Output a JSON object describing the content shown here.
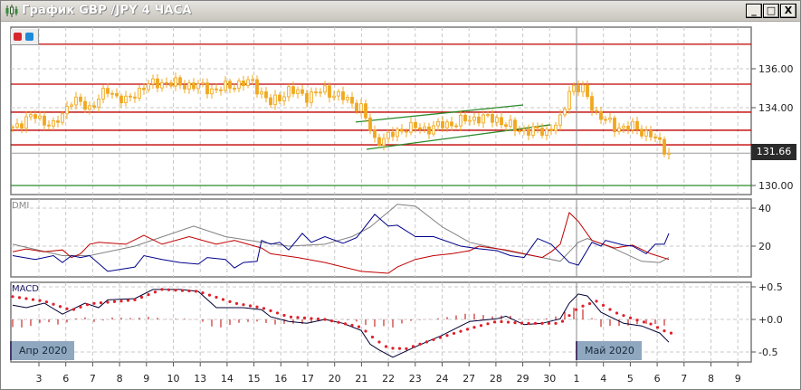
{
  "window": {
    "title": "График GBP /JPY  4 ЧАСА",
    "minimize_label": "_",
    "maximize_label": "□",
    "close_label": "X"
  },
  "colors": {
    "candle": "#f0a820",
    "level": "#c00000",
    "trend": "#2a8a2a",
    "adx": "#808080",
    "plus_di": "#c00000",
    "minus_di": "#00008b",
    "macd": "#000033",
    "signal": "#e0202a",
    "histogram": "#c00000"
  },
  "current_price": "131.66",
  "indicators": {
    "dmi_label": "DMI",
    "macd_label": "MACD"
  },
  "months": {
    "apr": "Апр 2020",
    "may": "Май 2020"
  },
  "chart_data": {
    "type": "line",
    "title": "GBP/JPY 4H",
    "x_tick_labels": [
      "3",
      "6",
      "7",
      "8",
      "9",
      "10",
      "13",
      "14",
      "15",
      "16",
      "17",
      "20",
      "21",
      "22",
      "23",
      "24",
      "27",
      "28",
      "29",
      "30",
      "1",
      "4",
      "5",
      "6",
      "7",
      "8",
      "9"
    ],
    "price_axis": {
      "ticks": [
        "136.00",
        "134.00",
        "130.00"
      ],
      "tick_values": [
        136,
        134,
        130
      ],
      "ylim": [
        129.5,
        138.2
      ]
    },
    "price_close_keypoints": [
      [
        0,
        133.0
      ],
      [
        5,
        133.6
      ],
      [
        9,
        133.0
      ],
      [
        13,
        134.4
      ],
      [
        17,
        134.0
      ],
      [
        21,
        134.9
      ],
      [
        25,
        134.3
      ],
      [
        29,
        135.1
      ],
      [
        33,
        135.3
      ],
      [
        37,
        135.2
      ],
      [
        41,
        135.1
      ],
      [
        45,
        134.9
      ],
      [
        49,
        135.2
      ],
      [
        53,
        135.3
      ],
      [
        57,
        134.2
      ],
      [
        61,
        134.9
      ],
      [
        65,
        134.6
      ],
      [
        69,
        134.9
      ],
      [
        73,
        134.5
      ],
      [
        77,
        134.0
      ],
      [
        80,
        132.3
      ],
      [
        83,
        132.5
      ],
      [
        87,
        133.0
      ],
      [
        91,
        132.9
      ],
      [
        95,
        133.1
      ],
      [
        99,
        133.3
      ],
      [
        103,
        133.5
      ],
      [
        107,
        133.4
      ],
      [
        111,
        132.9
      ],
      [
        115,
        132.8
      ],
      [
        118,
        132.8
      ],
      [
        121,
        133.3
      ],
      [
        123,
        134.9
      ],
      [
        124,
        135.1
      ],
      [
        126,
        134.9
      ],
      [
        129,
        133.7
      ],
      [
        133,
        133.0
      ],
      [
        137,
        133.0
      ],
      [
        141,
        132.6
      ],
      [
        144,
        131.9
      ],
      [
        145,
        131.66
      ]
    ],
    "horizontal_levels": [
      137.26,
      135.21,
      133.77,
      132.84,
      132.09
    ],
    "support_level": 130.0,
    "trend_lines": [
      [
        [
          75.8,
          133.26
        ],
        [
          112.8,
          134.14
        ]
      ],
      [
        [
          78.2,
          131.86
        ],
        [
          118.8,
          133.12
        ]
      ]
    ],
    "dmi": {
      "ticks": [
        "40",
        "20"
      ],
      "tick_values": [
        40,
        20
      ],
      "ylim": [
        3.8,
        44.8
      ],
      "adx": [
        [
          0,
          21
        ],
        [
          11,
          15
        ],
        [
          17,
          15
        ],
        [
          27,
          20
        ],
        [
          40,
          30.5
        ],
        [
          47,
          25
        ],
        [
          55,
          22
        ],
        [
          61,
          20
        ],
        [
          69,
          21
        ],
        [
          75,
          25
        ],
        [
          79,
          30
        ],
        [
          85,
          42
        ],
        [
          89,
          41
        ],
        [
          95,
          30
        ],
        [
          101,
          22
        ],
        [
          109,
          17.6
        ],
        [
          117,
          14
        ],
        [
          121,
          12
        ],
        [
          125,
          22
        ],
        [
          127,
          24
        ],
        [
          133,
          18.6
        ],
        [
          139,
          12
        ],
        [
          143,
          11.4
        ],
        [
          145,
          14
        ]
      ],
      "plus_di": [
        [
          0,
          17
        ],
        [
          3,
          18.5
        ],
        [
          7,
          17
        ],
        [
          11,
          18
        ],
        [
          13,
          14
        ],
        [
          15,
          16
        ],
        [
          17,
          21
        ],
        [
          19,
          22
        ],
        [
          25,
          21
        ],
        [
          29,
          25.7
        ],
        [
          33,
          21
        ],
        [
          39,
          25
        ],
        [
          45,
          21
        ],
        [
          49,
          23
        ],
        [
          55,
          19
        ],
        [
          57,
          16
        ],
        [
          63,
          14
        ],
        [
          69,
          11.4
        ],
        [
          77,
          6.7
        ],
        [
          83,
          5.7
        ],
        [
          85,
          9
        ],
        [
          89,
          13
        ],
        [
          93,
          15
        ],
        [
          97,
          16
        ],
        [
          101,
          17.6
        ],
        [
          103,
          20
        ],
        [
          109,
          18
        ],
        [
          117,
          14
        ],
        [
          119,
          17
        ],
        [
          121,
          21
        ],
        [
          123,
          37.6
        ],
        [
          125,
          33
        ],
        [
          128,
          23
        ],
        [
          133,
          19
        ],
        [
          137,
          20.5
        ],
        [
          141,
          16
        ],
        [
          145,
          13
        ]
      ],
      "minus_di": [
        [
          0,
          15
        ],
        [
          5,
          13
        ],
        [
          9,
          15
        ],
        [
          11,
          11.4
        ],
        [
          13,
          15
        ],
        [
          15,
          14
        ],
        [
          17,
          15
        ],
        [
          21,
          6.7
        ],
        [
          27,
          9
        ],
        [
          29,
          15
        ],
        [
          33,
          13
        ],
        [
          37,
          11.4
        ],
        [
          41,
          10.5
        ],
        [
          43,
          14
        ],
        [
          47,
          13
        ],
        [
          49,
          8.5
        ],
        [
          51,
          11.4
        ],
        [
          54,
          12
        ],
        [
          55,
          23
        ],
        [
          57,
          21
        ],
        [
          59,
          22
        ],
        [
          61,
          18
        ],
        [
          64,
          26.7
        ],
        [
          66,
          22
        ],
        [
          69,
          25
        ],
        [
          73,
          21.5
        ],
        [
          76,
          24.5
        ],
        [
          80,
          36.7
        ],
        [
          83,
          30.5
        ],
        [
          85,
          31
        ],
        [
          89,
          25
        ],
        [
          93,
          25
        ],
        [
          99,
          20
        ],
        [
          103,
          18.6
        ],
        [
          107,
          17.6
        ],
        [
          110,
          15
        ],
        [
          113,
          14
        ],
        [
          116,
          24
        ],
        [
          119,
          21
        ],
        [
          123,
          11.4
        ],
        [
          125,
          10
        ],
        [
          128,
          22
        ],
        [
          130,
          20
        ],
        [
          131,
          23
        ],
        [
          135,
          20.5
        ],
        [
          137,
          20
        ],
        [
          140,
          16
        ],
        [
          142,
          21
        ],
        [
          144,
          21
        ],
        [
          145,
          26.7
        ]
      ]
    },
    "macd": {
      "ticks": [
        "+0.5",
        "+0.0",
        "-0.5"
      ],
      "tick_values": [
        0.5,
        0,
        -0.5
      ],
      "ylim": [
        -0.65,
        0.6
      ],
      "main": [
        [
          0,
          0.22
        ],
        [
          3,
          0.18
        ],
        [
          7,
          0.25
        ],
        [
          11,
          0.08
        ],
        [
          16,
          0.25
        ],
        [
          19,
          0.18
        ],
        [
          21,
          0.3
        ],
        [
          27,
          0.32
        ],
        [
          31,
          0.46
        ],
        [
          37,
          0.46
        ],
        [
          41,
          0.43
        ],
        [
          45,
          0.18
        ],
        [
          51,
          0.18
        ],
        [
          55,
          0.15
        ],
        [
          57,
          0.04
        ],
        [
          61,
          -0.03
        ],
        [
          65,
          -0.06
        ],
        [
          69,
          0.0
        ],
        [
          73,
          -0.06
        ],
        [
          77,
          -0.17
        ],
        [
          79,
          -0.38
        ],
        [
          81,
          -0.47
        ],
        [
          84,
          -0.58
        ],
        [
          89,
          -0.42
        ],
        [
          95,
          -0.24
        ],
        [
          101,
          -0.03
        ],
        [
          107,
          0.01
        ],
        [
          109,
          0.05
        ],
        [
          113,
          -0.08
        ],
        [
          117,
          -0.06
        ],
        [
          121,
          0.01
        ],
        [
          123,
          0.25
        ],
        [
          125,
          0.39
        ],
        [
          127,
          0.36
        ],
        [
          130,
          0.11
        ],
        [
          135,
          -0.06
        ],
        [
          139,
          -0.1
        ],
        [
          143,
          -0.21
        ],
        [
          145,
          -0.35
        ]
      ],
      "signal": [
        [
          0,
          0.35
        ],
        [
          7,
          0.28
        ],
        [
          13,
          0.14
        ],
        [
          17,
          0.24
        ],
        [
          27,
          0.3
        ],
        [
          33,
          0.46
        ],
        [
          41,
          0.43
        ],
        [
          49,
          0.25
        ],
        [
          55,
          0.18
        ],
        [
          61,
          0.04
        ],
        [
          69,
          0.0
        ],
        [
          77,
          -0.12
        ],
        [
          80,
          -0.3
        ],
        [
          83,
          -0.44
        ],
        [
          87,
          -0.45
        ],
        [
          93,
          -0.31
        ],
        [
          101,
          -0.14
        ],
        [
          107,
          -0.03
        ],
        [
          113,
          -0.06
        ],
        [
          121,
          -0.06
        ],
        [
          125,
          0.18
        ],
        [
          129,
          0.28
        ],
        [
          133,
          0.11
        ],
        [
          137,
          0.01
        ],
        [
          141,
          -0.07
        ],
        [
          145,
          -0.21
        ]
      ]
    },
    "bar_count": 146,
    "period_separator_bar": 124.6
  }
}
